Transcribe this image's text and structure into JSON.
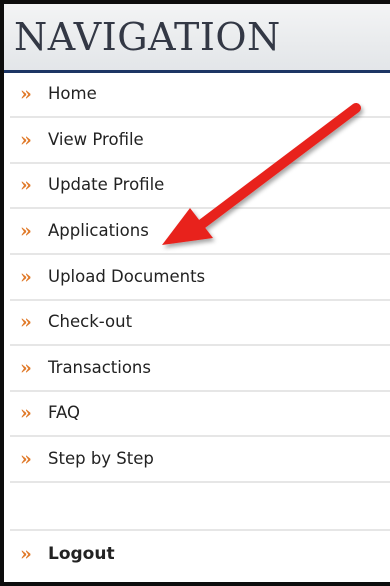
{
  "header": {
    "title": "NAVIGATION"
  },
  "menu": {
    "items": [
      {
        "label": "Home",
        "icon": "double-chevron-right"
      },
      {
        "label": "View Profile",
        "icon": "double-chevron-right"
      },
      {
        "label": "Update Profile",
        "icon": "double-chevron-right"
      },
      {
        "label": "Applications",
        "icon": "double-chevron-right"
      },
      {
        "label": "Upload Documents",
        "icon": "double-chevron-right"
      },
      {
        "label": "Check-out",
        "icon": "double-chevron-right"
      },
      {
        "label": "Transactions",
        "icon": "double-chevron-right"
      },
      {
        "label": "FAQ",
        "icon": "double-chevron-right"
      },
      {
        "label": "Step by Step",
        "icon": "double-chevron-right"
      }
    ],
    "logout": {
      "label": "Logout",
      "icon": "double-chevron-right"
    },
    "chevron_glyph": "»"
  },
  "colors": {
    "chevron": "#e07a2a",
    "header_rule": "#1c3564",
    "annotation_arrow": "#e8231f"
  },
  "annotation": {
    "type": "arrow",
    "target": "Applications"
  }
}
